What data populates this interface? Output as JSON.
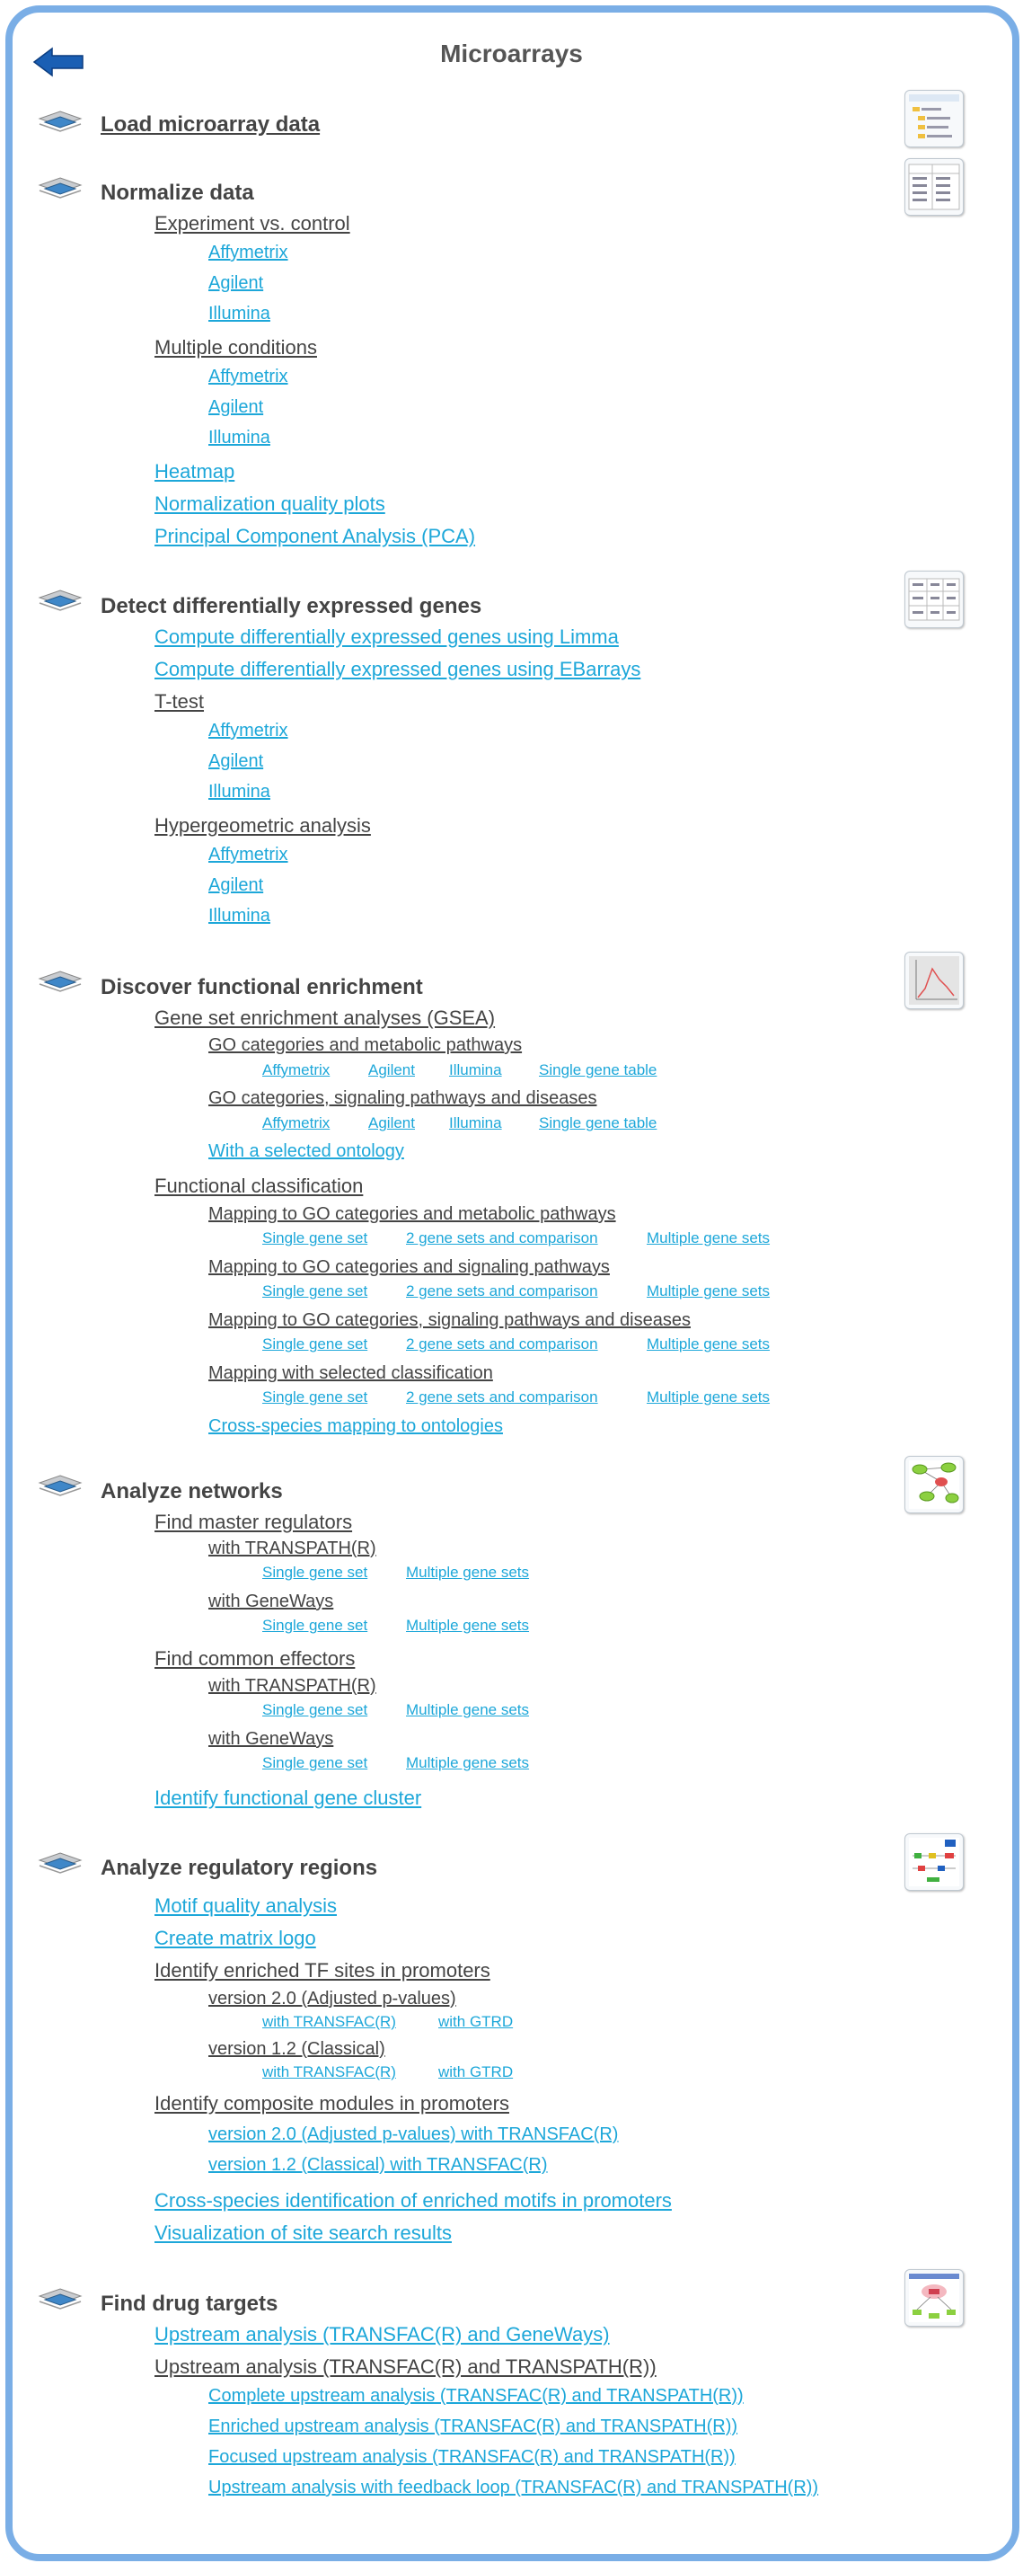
{
  "page": {
    "title": "Microarrays"
  },
  "sections": {
    "load": {
      "title": "Load microarray data"
    },
    "normalize": {
      "title": "Normalize data",
      "exp_vs_control": "Experiment vs. control",
      "multiple_conditions": "Multiple conditions",
      "heatmap": "Heatmap",
      "quality_plots": "Normalization quality plots",
      "pca": "Principal Component Analysis (PCA)"
    },
    "detect": {
      "title": "Detect differentially expressed genes",
      "limma": "Compute differentially expressed genes using Limma",
      "ebarrays": "Compute differentially expressed genes using EBarrays",
      "ttest": "T-test",
      "hypergeometric": "Hypergeometric analysis"
    },
    "functional": {
      "title": "Discover functional enrichment",
      "gsea": "Gene set enrichment analyses (GSEA)",
      "go_metabolic": "GO categories and metabolic pathways",
      "go_signaling_diseases": "GO categories, signaling pathways and diseases",
      "selected_ontology": "With a selected ontology",
      "classification": "Functional classification",
      "map_go_metabolic": "Mapping to GO categories and metabolic pathways",
      "map_go_signaling": "Mapping to GO categories and signaling pathways",
      "map_go_signaling_diseases": "Mapping to GO categories, signaling pathways and diseases",
      "map_selected": "Mapping with selected classification",
      "cross_species": "Cross-species mapping to ontologies"
    },
    "networks": {
      "title": "Analyze networks",
      "master_regulators": "Find master regulators",
      "common_effectors": "Find common effectors",
      "with_transpath": "with TRANSPATH(R)",
      "with_geneways": "with GeneWays",
      "gene_cluster": "Identify functional gene cluster"
    },
    "regulatory": {
      "title": "Analyze regulatory regions",
      "motif_quality": "Motif quality analysis",
      "matrix_logo": "Create matrix logo",
      "enriched_tf": "Identify enriched TF sites in promoters",
      "v2_adjusted": "version 2.0 (Adjusted p-values)",
      "v1_classical": "version 1.2 (Classical)",
      "with_transfac": "with TRANSFAC(R)",
      "with_gtrd": "with GTRD",
      "composite_modules": "Identify composite modules in promoters",
      "v2_transfac": "version 2.0 (Adjusted p-values) with TRANSFAC(R)",
      "v1_transfac": "version 1.2 (Classical) with TRANSFAC(R)",
      "cross_species_motifs": "Cross-species identification of enriched motifs in promoters",
      "visualization": "Visualization of site search results"
    },
    "drug": {
      "title": "Find drug targets",
      "upstream_geneways": "Upstream analysis (TRANSFAC(R) and GeneWays)",
      "upstream_transpath": "Upstream analysis (TRANSFAC(R) and TRANSPATH(R))",
      "complete": "Complete upstream analysis (TRANSFAC(R) and TRANSPATH(R))",
      "enriched": "Enriched upstream analysis (TRANSFAC(R) and TRANSPATH(R))",
      "focused": "Focused upstream analysis (TRANSFAC(R) and TRANSPATH(R))",
      "feedback": "Upstream analysis with feedback loop (TRANSFAC(R) and TRANSPATH(R))"
    }
  },
  "common": {
    "affymetrix": "Affymetrix",
    "agilent": "Agilent",
    "illumina": "Illumina",
    "single_gene_table": "Single gene table",
    "single_gene_set": "Single gene set",
    "two_gene_sets": "2 gene sets and comparison",
    "multiple_gene_sets": "Multiple gene sets"
  },
  "colors": {
    "link": "#1da7d9",
    "frame": "#7aaee6",
    "heading": "#444444",
    "back_arrow": "#1a5fb4"
  },
  "icons": {
    "back": "back-arrow-icon",
    "section": "stacked-diamonds-icon"
  }
}
